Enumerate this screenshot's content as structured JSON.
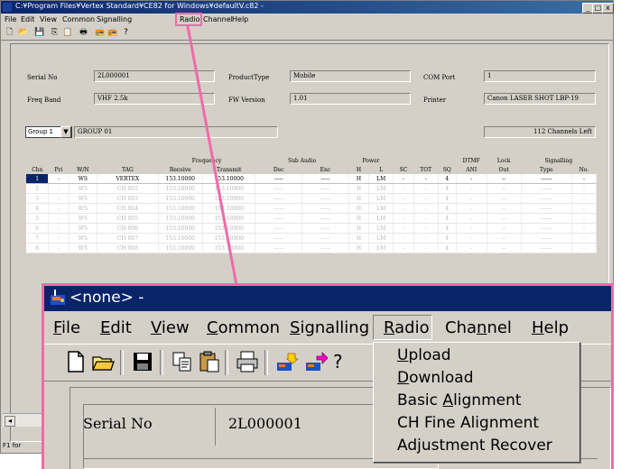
{
  "background_window": {
    "title": "C:¥Program Files¥Vertex Standard¥CE82 for Windows¥defaultV.c82 -",
    "controls": [
      "_",
      "□",
      "x"
    ],
    "menu": [
      "File",
      "Edit",
      "View",
      "Common",
      "Signalling",
      "Radio",
      "Channel",
      "Help"
    ],
    "fields": {
      "serial_no": {
        "label": "Serial No",
        "value": "2L000001"
      },
      "product_type": {
        "label": "ProductType",
        "value": "Mobile"
      },
      "com_port": {
        "label": "COM Port",
        "value": "1"
      },
      "freq_band": {
        "label": "Freq Band",
        "value": "VHF 2.5k"
      },
      "fw_version": {
        "label": "FW Version",
        "value": "1.01"
      },
      "printer": {
        "label": "Printer",
        "value": "Canon LASER SHOT LBP-19"
      }
    },
    "group_select": "Group 1",
    "group_name": "GROUP 01",
    "channels_left": "112 Channels Left",
    "table": {
      "header_groups": {
        "frequency": "Frequency",
        "sub_audio": "Sub Audio",
        "power": "Power",
        "dtmf": "DTMF",
        "lock": "Lock",
        "signalling": "Signalling"
      },
      "columns": [
        "Chn",
        "Pri",
        "W/N",
        "TAG",
        "Receive",
        "Transmit",
        "Dec",
        "Enc",
        "H",
        "L",
        "SC",
        "TOT",
        "SQ",
        "ANI",
        "Out",
        "Type",
        "No."
      ],
      "rows": [
        [
          "1",
          "-",
          "WS",
          "VERTEX",
          "153.10000",
          "153.10000",
          "-----",
          "-----",
          "H",
          "LM",
          "-",
          "-",
          "4",
          "-",
          "--",
          "------",
          "-"
        ],
        [
          "2",
          "-",
          "WS",
          "CH 002",
          "153.10000",
          "153.10000",
          "-----",
          "-----",
          "H",
          "LM",
          "-",
          "-",
          "4",
          "-",
          "--",
          "------",
          "-"
        ],
        [
          "3",
          "-",
          "WS",
          "CH 003",
          "153.10000",
          "153.10000",
          "-----",
          "-----",
          "H",
          "LM",
          "-",
          "-",
          "4",
          "-",
          "--",
          "------",
          "-"
        ],
        [
          "4",
          "-",
          "WS",
          "CH 004",
          "153.10000",
          "153.10000",
          "-----",
          "-----",
          "H",
          "LM",
          "-",
          "-",
          "4",
          "-",
          "--",
          "------",
          "-"
        ],
        [
          "5",
          "-",
          "WS",
          "CH 005",
          "153.10000",
          "153.10000",
          "-----",
          "-----",
          "H",
          "LM",
          "-",
          "-",
          "4",
          "-",
          "--",
          "------",
          "-"
        ],
        [
          "6",
          "-",
          "WS",
          "CH 006",
          "153.10000",
          "153.10000",
          "-----",
          "-----",
          "H",
          "LM",
          "-",
          "-",
          "4",
          "-",
          "--",
          "------",
          "-"
        ],
        [
          "7",
          "-",
          "WS",
          "CH 007",
          "153.10000",
          "153.10000",
          "-----",
          "-----",
          "H",
          "LM",
          "-",
          "-",
          "4",
          "-",
          "--",
          "------",
          "-"
        ],
        [
          "8",
          "-",
          "WS",
          "CH 008",
          "153.10000",
          "153.10000",
          "-----",
          "-----",
          "H",
          "LM",
          "-",
          "-",
          "4",
          "-",
          "--",
          "------",
          "-"
        ]
      ]
    },
    "status": "F1 for"
  },
  "zoom_window": {
    "title": "<none> -",
    "menu": [
      {
        "label": "File",
        "ul": "F",
        "rest": "ile"
      },
      {
        "label": "Edit",
        "ul": "E",
        "rest": "dit"
      },
      {
        "label": "View",
        "ul": "V",
        "rest": "iew"
      },
      {
        "label": "Common",
        "ul": "C",
        "rest": "ommon"
      },
      {
        "label": "Signalling",
        "ul": "S",
        "rest": "ignalling"
      },
      {
        "label": "Radio",
        "ul": "R",
        "rest": "adio"
      },
      {
        "label": "Channel",
        "pre": "Cha",
        "ul": "n",
        "rest": "nel"
      },
      {
        "label": "Help",
        "ul": "H",
        "rest": "elp"
      }
    ],
    "radio_menu": [
      {
        "pre": "",
        "ul": "U",
        "rest": "pload"
      },
      {
        "pre": "",
        "ul": "D",
        "rest": "ownload"
      },
      {
        "pre": "Basic ",
        "ul": "A",
        "rest": "lignment"
      },
      {
        "pre": "CH Fine Alignment",
        "ul": "",
        "rest": ""
      },
      {
        "pre": "Adjustment Recover",
        "ul": "",
        "rest": ""
      }
    ],
    "serial_label": "Serial No",
    "serial_value": "2L000001"
  },
  "colors": {
    "highlight": "#f06aa8",
    "titlebar": "#0a246a",
    "face": "#d4d0c8"
  },
  "icons": [
    "new-file-icon",
    "open-folder-icon",
    "save-disk-icon",
    "copy-icon",
    "paste-icon",
    "print-icon",
    "upload-radio-icon",
    "download-radio-icon",
    "help-icon"
  ]
}
